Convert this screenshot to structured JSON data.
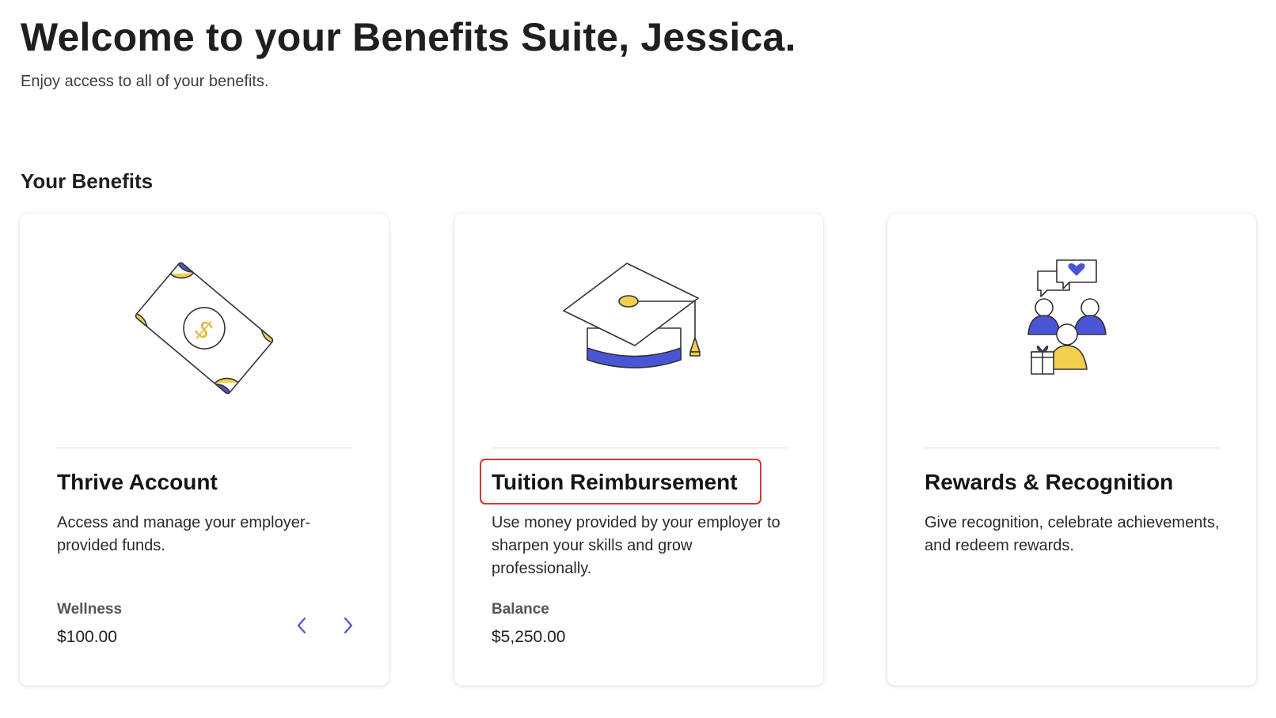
{
  "header": {
    "title": "Welcome to your Benefits Suite, Jessica.",
    "subtitle": "Enjoy access to all of your benefits."
  },
  "section": {
    "title": "Your Benefits"
  },
  "cards": [
    {
      "title": "Thrive Account",
      "description": "Access and manage your employer-provided funds.",
      "balance_label": "Wellness",
      "balance_value": "$100.00",
      "icon": "money-bill-icon"
    },
    {
      "title": "Tuition Reimbursement",
      "description": "Use money provided by your employer to sharpen your skills and grow professionally.",
      "balance_label": "Balance",
      "balance_value": "$5,250.00",
      "icon": "graduation-cap-icon",
      "highlighted": true
    },
    {
      "title": "Rewards & Recognition",
      "description": "Give recognition, celebrate achievements, and redeem rewards.",
      "icon": "people-recognition-icon"
    }
  ],
  "colors": {
    "accent_blue": "#4a55d6",
    "accent_yellow": "#f2d04e",
    "highlight_red": "#d23a2f"
  }
}
